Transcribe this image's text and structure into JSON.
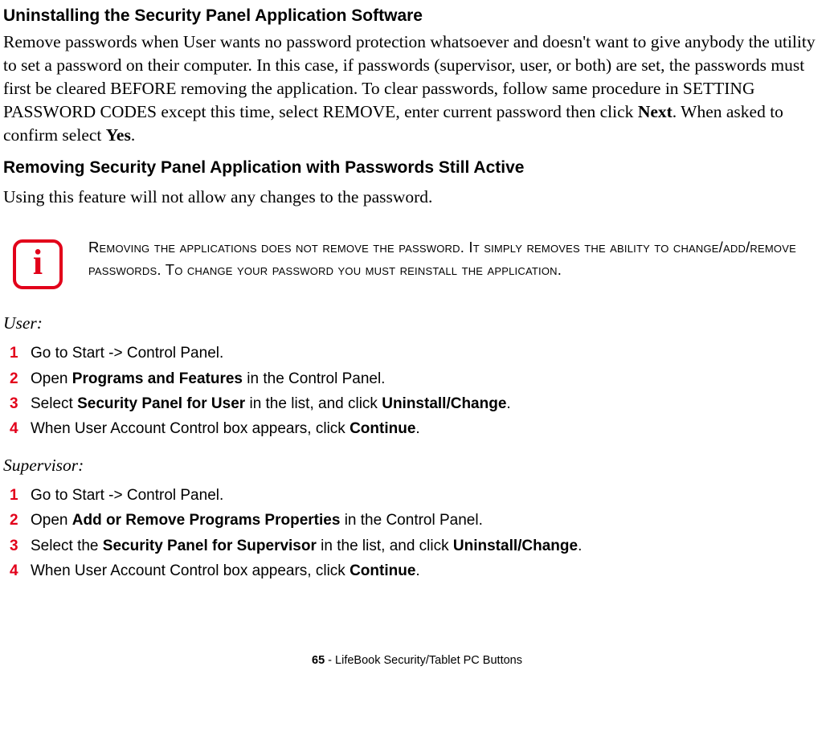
{
  "heading1": "Uninstalling the Security Panel Application Software",
  "para1_pre": "Remove passwords when User wants no password protection whatsoever and doesn't want to give anybody the utility to set a password on their computer. In this case, if passwords (supervisor, user, or both) are set, the passwords must first be cleared BEFORE removing the application. To clear passwords, follow same procedure in SETTING PASSWORD CODES except this time, select REMOVE, enter current password then click ",
  "para1_b1": "Next",
  "para1_mid": ". When asked to confirm select ",
  "para1_b2": "Yes",
  "para1_end": ".",
  "heading2": "Removing Security Panel Application with Passwords Still Active",
  "para2": "Using this feature will not allow any changes to the password.",
  "info_icon_letter": "i",
  "info_text": "Removing the applications does not remove the password. It simply removes the ability to change/add/remove passwords. To change your password you must reinstall the application.",
  "user_label": "User:",
  "user_steps": [
    {
      "num": "1",
      "pre": "Go to Start -> Control Panel.",
      "b1": "",
      "mid": "",
      "b2": "",
      "end": ""
    },
    {
      "num": "2",
      "pre": "Open ",
      "b1": "Programs and Features",
      "mid": " in the Control Panel.",
      "b2": "",
      "end": ""
    },
    {
      "num": "3",
      "pre": "Select ",
      "b1": "Security Panel for User",
      "mid": " in the list, and click ",
      "b2": "Uninstall/Change",
      "end": "."
    },
    {
      "num": "4",
      "pre": "When User Account Control box appears, click ",
      "b1": "Continue",
      "mid": ".",
      "b2": "",
      "end": ""
    }
  ],
  "supervisor_label": "Supervisor:",
  "supervisor_steps": [
    {
      "num": "1",
      "pre": "Go to Start -> Control Panel.",
      "b1": "",
      "mid": "",
      "b2": "",
      "end": ""
    },
    {
      "num": "2",
      "pre": "Open ",
      "b1": "Add or Remove Programs Properties",
      "mid": " in the Control Panel.",
      "b2": "",
      "end": ""
    },
    {
      "num": "3",
      "pre": "Select the ",
      "b1": "Security Panel for Supervisor",
      "mid": " in the list, and click ",
      "b2": "Uninstall/Change",
      "end": "."
    },
    {
      "num": "4",
      "pre": "When User Account Control box appears, click ",
      "b1": "Continue",
      "mid": ".",
      "b2": "",
      "end": ""
    }
  ],
  "footer_num": "65",
  "footer_sep": " - ",
  "footer_text": "LifeBook Security/Tablet PC Buttons"
}
